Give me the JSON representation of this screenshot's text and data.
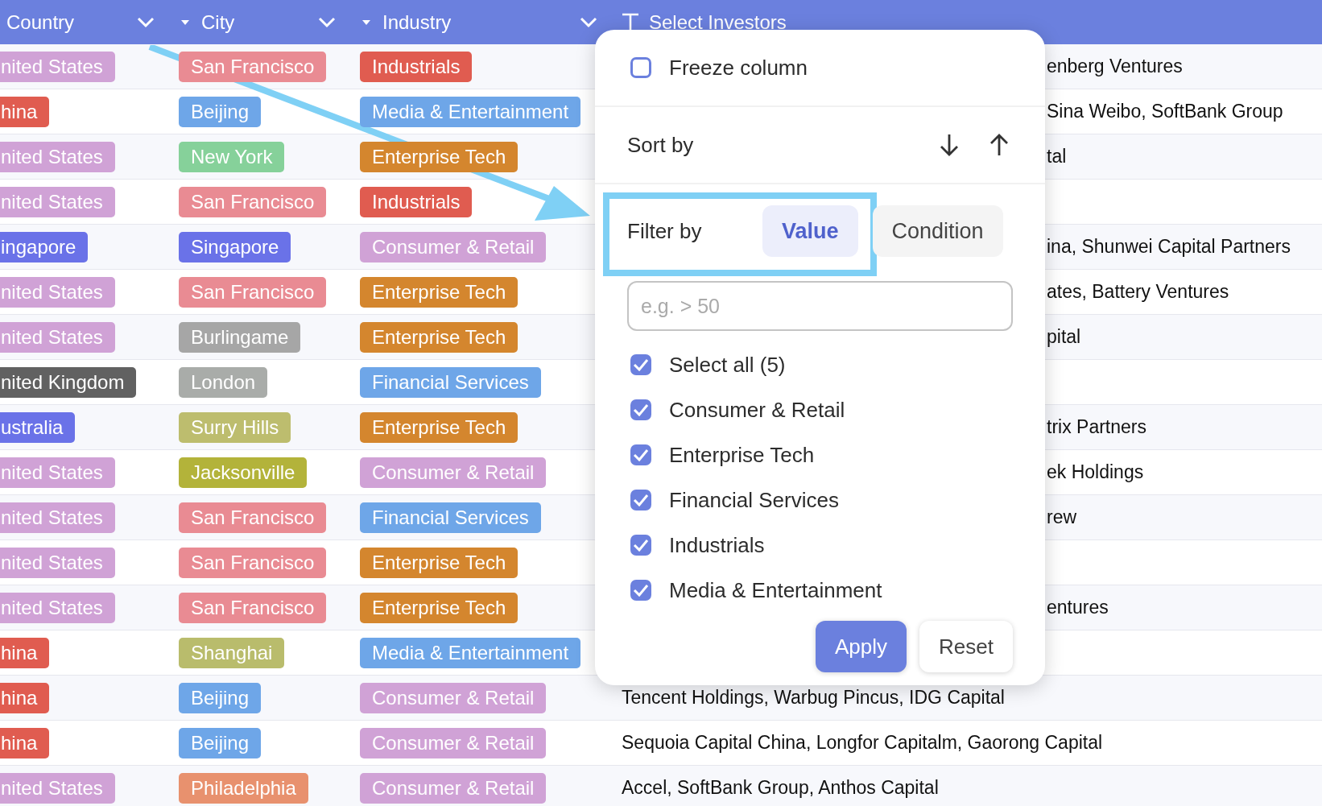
{
  "columns": [
    {
      "label": "Country",
      "kind": "tag"
    },
    {
      "label": "City",
      "kind": "tag"
    },
    {
      "label": "Industry",
      "kind": "tag"
    },
    {
      "label": "Select Investors",
      "kind": "text"
    }
  ],
  "rows": [
    {
      "country": {
        "text": "nited States",
        "color": "#d0a2d6"
      },
      "city": {
        "text": "San Francisco",
        "color": "#e98b93"
      },
      "industry": {
        "text": "Industrials",
        "color": "#e05c50"
      },
      "investors": "enberg Ventures"
    },
    {
      "country": {
        "text": "hina",
        "color": "#e05c50"
      },
      "city": {
        "text": "Beijing",
        "color": "#6ea6e8"
      },
      "industry": {
        "text": "Media & Entertainment",
        "color": "#6ea6e8"
      },
      "investors": "Sina Weibo, SoftBank Group"
    },
    {
      "country": {
        "text": "nited States",
        "color": "#d0a2d6"
      },
      "city": {
        "text": "New York",
        "color": "#86d19a"
      },
      "industry": {
        "text": "Enterprise Tech",
        "color": "#d4862e"
      },
      "investors": "tal"
    },
    {
      "country": {
        "text": "nited States",
        "color": "#d0a2d6"
      },
      "city": {
        "text": "San Francisco",
        "color": "#e98b93"
      },
      "industry": {
        "text": "Industrials",
        "color": "#e05c50"
      }
    },
    {
      "country": {
        "text": "ingapore",
        "color": "#6a72e8"
      },
      "city": {
        "text": "Singapore",
        "color": "#6a72e8"
      },
      "industry": {
        "text": "Consumer & Retail",
        "color": "#d0a2d6"
      },
      "investors": "ina, Shunwei Capital Partners"
    },
    {
      "country": {
        "text": "nited States",
        "color": "#d0a2d6"
      },
      "city": {
        "text": "San Francisco",
        "color": "#e98b93"
      },
      "industry": {
        "text": "Enterprise Tech",
        "color": "#d4862e"
      },
      "investors": "ates, Battery Ventures"
    },
    {
      "country": {
        "text": "nited States",
        "color": "#d0a2d6"
      },
      "city": {
        "text": "Burlingame",
        "color": "#a6a6a6"
      },
      "industry": {
        "text": "Enterprise Tech",
        "color": "#d4862e"
      },
      "investors": "pital"
    },
    {
      "country": {
        "text": "nited Kingdom",
        "color": "#616161"
      },
      "city": {
        "text": "London",
        "color": "#a9aca9"
      },
      "industry": {
        "text": "Financial Services",
        "color": "#6ea6e8"
      }
    },
    {
      "country": {
        "text": "ustralia",
        "color": "#6a72e8"
      },
      "city": {
        "text": "Surry Hills",
        "color": "#bdbd6e"
      },
      "industry": {
        "text": "Enterprise Tech",
        "color": "#d4862e"
      },
      "investors": "trix Partners"
    },
    {
      "country": {
        "text": "nited States",
        "color": "#d0a2d6"
      },
      "city": {
        "text": "Jacksonville",
        "color": "#b3b33a"
      },
      "industry": {
        "text": "Consumer & Retail",
        "color": "#d0a2d6"
      },
      "investors": "ek Holdings"
    },
    {
      "country": {
        "text": "nited States",
        "color": "#d0a2d6"
      },
      "city": {
        "text": "San Francisco",
        "color": "#e98b93"
      },
      "industry": {
        "text": "Financial Services",
        "color": "#6ea6e8"
      },
      "investors": "rew"
    },
    {
      "country": {
        "text": "nited States",
        "color": "#d0a2d6"
      },
      "city": {
        "text": "San Francisco",
        "color": "#e98b93"
      },
      "industry": {
        "text": "Enterprise Tech",
        "color": "#d4862e"
      }
    },
    {
      "country": {
        "text": "nited States",
        "color": "#d0a2d6"
      },
      "city": {
        "text": "San Francisco",
        "color": "#e98b93"
      },
      "industry": {
        "text": "Enterprise Tech",
        "color": "#d4862e"
      },
      "investors": "entures"
    },
    {
      "country": {
        "text": "hina",
        "color": "#e05c50"
      },
      "city": {
        "text": "Shanghai",
        "color": "#b9bc6c"
      },
      "industry": {
        "text": "Media & Entertainment",
        "color": "#6ea6e8"
      }
    },
    {
      "country": {
        "text": "hina",
        "color": "#e05c50"
      },
      "city": {
        "text": "Beijing",
        "color": "#6ea6e8"
      },
      "industry": {
        "text": "Consumer & Retail",
        "color": "#d0a2d6"
      },
      "investors": "Tencent Holdings, Warbug Pincus, IDG Capital"
    },
    {
      "country": {
        "text": "hina",
        "color": "#e05c50"
      },
      "city": {
        "text": "Beijing",
        "color": "#6ea6e8"
      },
      "industry": {
        "text": "Consumer & Retail",
        "color": "#d0a2d6"
      },
      "investors": "Sequoia Capital China, Longfor Capitalm, Gaorong Capital"
    },
    {
      "country": {
        "text": "nited States",
        "color": "#d0a2d6"
      },
      "city": {
        "text": "Philadelphia",
        "color": "#e8916e"
      },
      "industry": {
        "text": "Consumer & Retail",
        "color": "#d0a2d6"
      },
      "investors": "Accel, SoftBank Group, Anthos Capital"
    }
  ],
  "popup": {
    "freeze": {
      "label": "Freeze column",
      "checked": false
    },
    "sort_label": "Sort by",
    "filter_label": "Filter by",
    "filter_tabs": [
      {
        "label": "Value",
        "selected": true
      },
      {
        "label": "Condition",
        "selected": false
      }
    ],
    "search": {
      "placeholder": "e.g. > 50"
    },
    "options": [
      {
        "label": "Select all (5)",
        "checked": true
      },
      {
        "label": "Consumer & Retail",
        "checked": true
      },
      {
        "label": "Enterprise Tech",
        "checked": true
      },
      {
        "label": "Financial Services",
        "checked": true
      },
      {
        "label": "Industrials",
        "checked": true
      },
      {
        "label": "Media & Entertainment",
        "checked": true
      }
    ],
    "buttons": [
      {
        "label": "Apply",
        "kind": "primary"
      },
      {
        "label": "Reset",
        "kind": "secondary"
      }
    ]
  }
}
